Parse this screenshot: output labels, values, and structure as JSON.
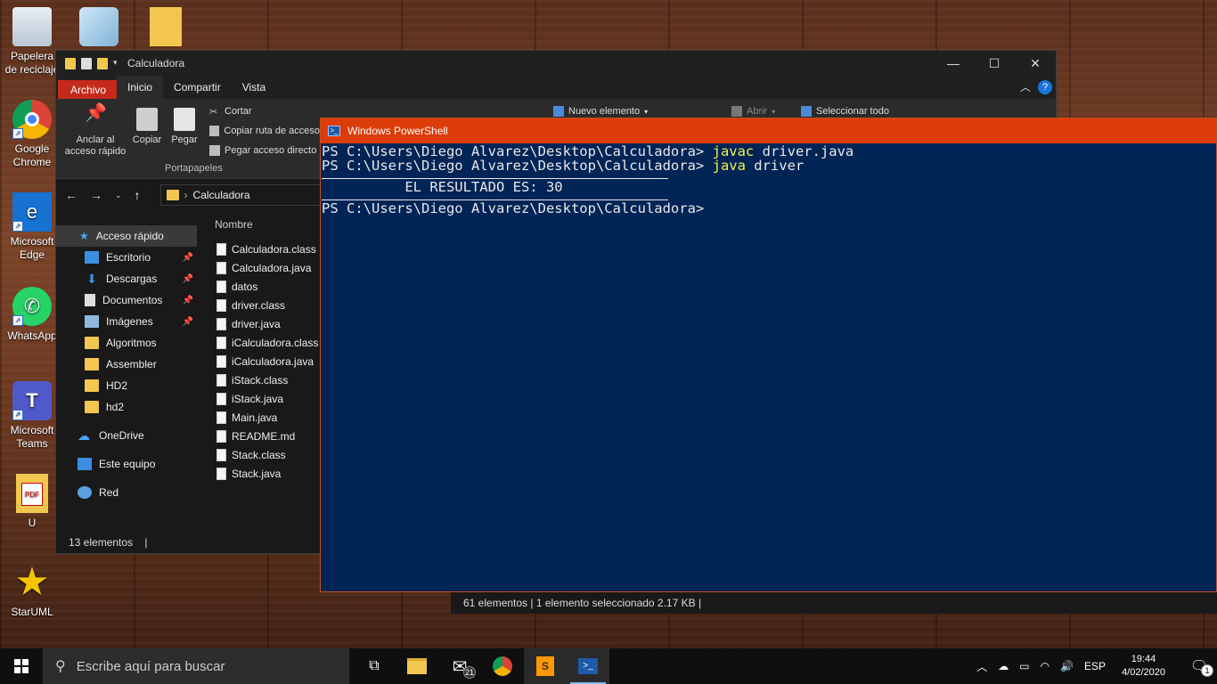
{
  "desktop": {
    "icons": [
      {
        "label": "Papelera de reciclaje"
      },
      {
        "label": "Google Chrome"
      },
      {
        "label": "Microsoft Edge"
      },
      {
        "label": "WhatsApp"
      },
      {
        "label": "Microsoft Teams"
      },
      {
        "label": "U"
      },
      {
        "label": "StarUML"
      }
    ]
  },
  "explorer": {
    "title": "Calculadora",
    "tabs": [
      "Archivo",
      "Inicio",
      "Compartir",
      "Vista"
    ],
    "ribbon": {
      "pin": "Anclar al acceso rápido",
      "copy": "Copiar",
      "paste": "Pegar",
      "cut": "Cortar",
      "copy_path": "Copiar ruta de acceso",
      "paste_shortcut": "Pegar acceso directo",
      "group_clipboard": "Portapapeles",
      "new_item": "Nuevo elemento",
      "open": "Abrir",
      "select_all": "Seleccionar todo"
    },
    "address": "Calculadora",
    "nav": {
      "quick_access": "Acceso rápido",
      "items": [
        "Escritorio",
        "Descargas",
        "Documentos",
        "Imágenes",
        "Algoritmos",
        "Assembler",
        "HD2",
        "hd2"
      ],
      "onedrive": "OneDrive",
      "this_pc": "Este equipo",
      "network": "Red"
    },
    "column_name": "Nombre",
    "files": [
      "Calculadora.class",
      "Calculadora.java",
      "datos",
      "driver.class",
      "driver.java",
      "iCalculadora.class",
      "iCalculadora.java",
      "iStack.class",
      "iStack.java",
      "Main.java",
      "README.md",
      "Stack.class",
      "Stack.java"
    ],
    "status": "13 elementos"
  },
  "powershell": {
    "title": "Windows PowerShell",
    "lines": {
      "l1_prompt": "PS C:\\Users\\Diego Alvarez\\Desktop\\Calculadora> ",
      "l1_cmd": "javac",
      "l1_arg": " driver.java",
      "l2_prompt": "PS C:\\Users\\Diego Alvarez\\Desktop\\Calculadora> ",
      "l2_cmd": "java",
      "l2_arg": " driver",
      "result": "          EL RESULTADO ES: 30",
      "l3_prompt": "PS C:\\Users\\Diego Alvarez\\Desktop\\Calculadora>"
    }
  },
  "background_window_status": "61 elementos   |   1 elemento seleccionado  2.17 KB   |",
  "taskbar": {
    "search_placeholder": "Escribe aquí para buscar",
    "mail_badge": "21",
    "language": "ESP",
    "time": "19:44",
    "date": "4/02/2020",
    "notifications": "1"
  },
  "colors": {
    "ps_background": "#012456",
    "ps_titlebar": "#dc3c08",
    "command_highlight": "#f2ef4b",
    "file_tab": "#c4291c"
  }
}
